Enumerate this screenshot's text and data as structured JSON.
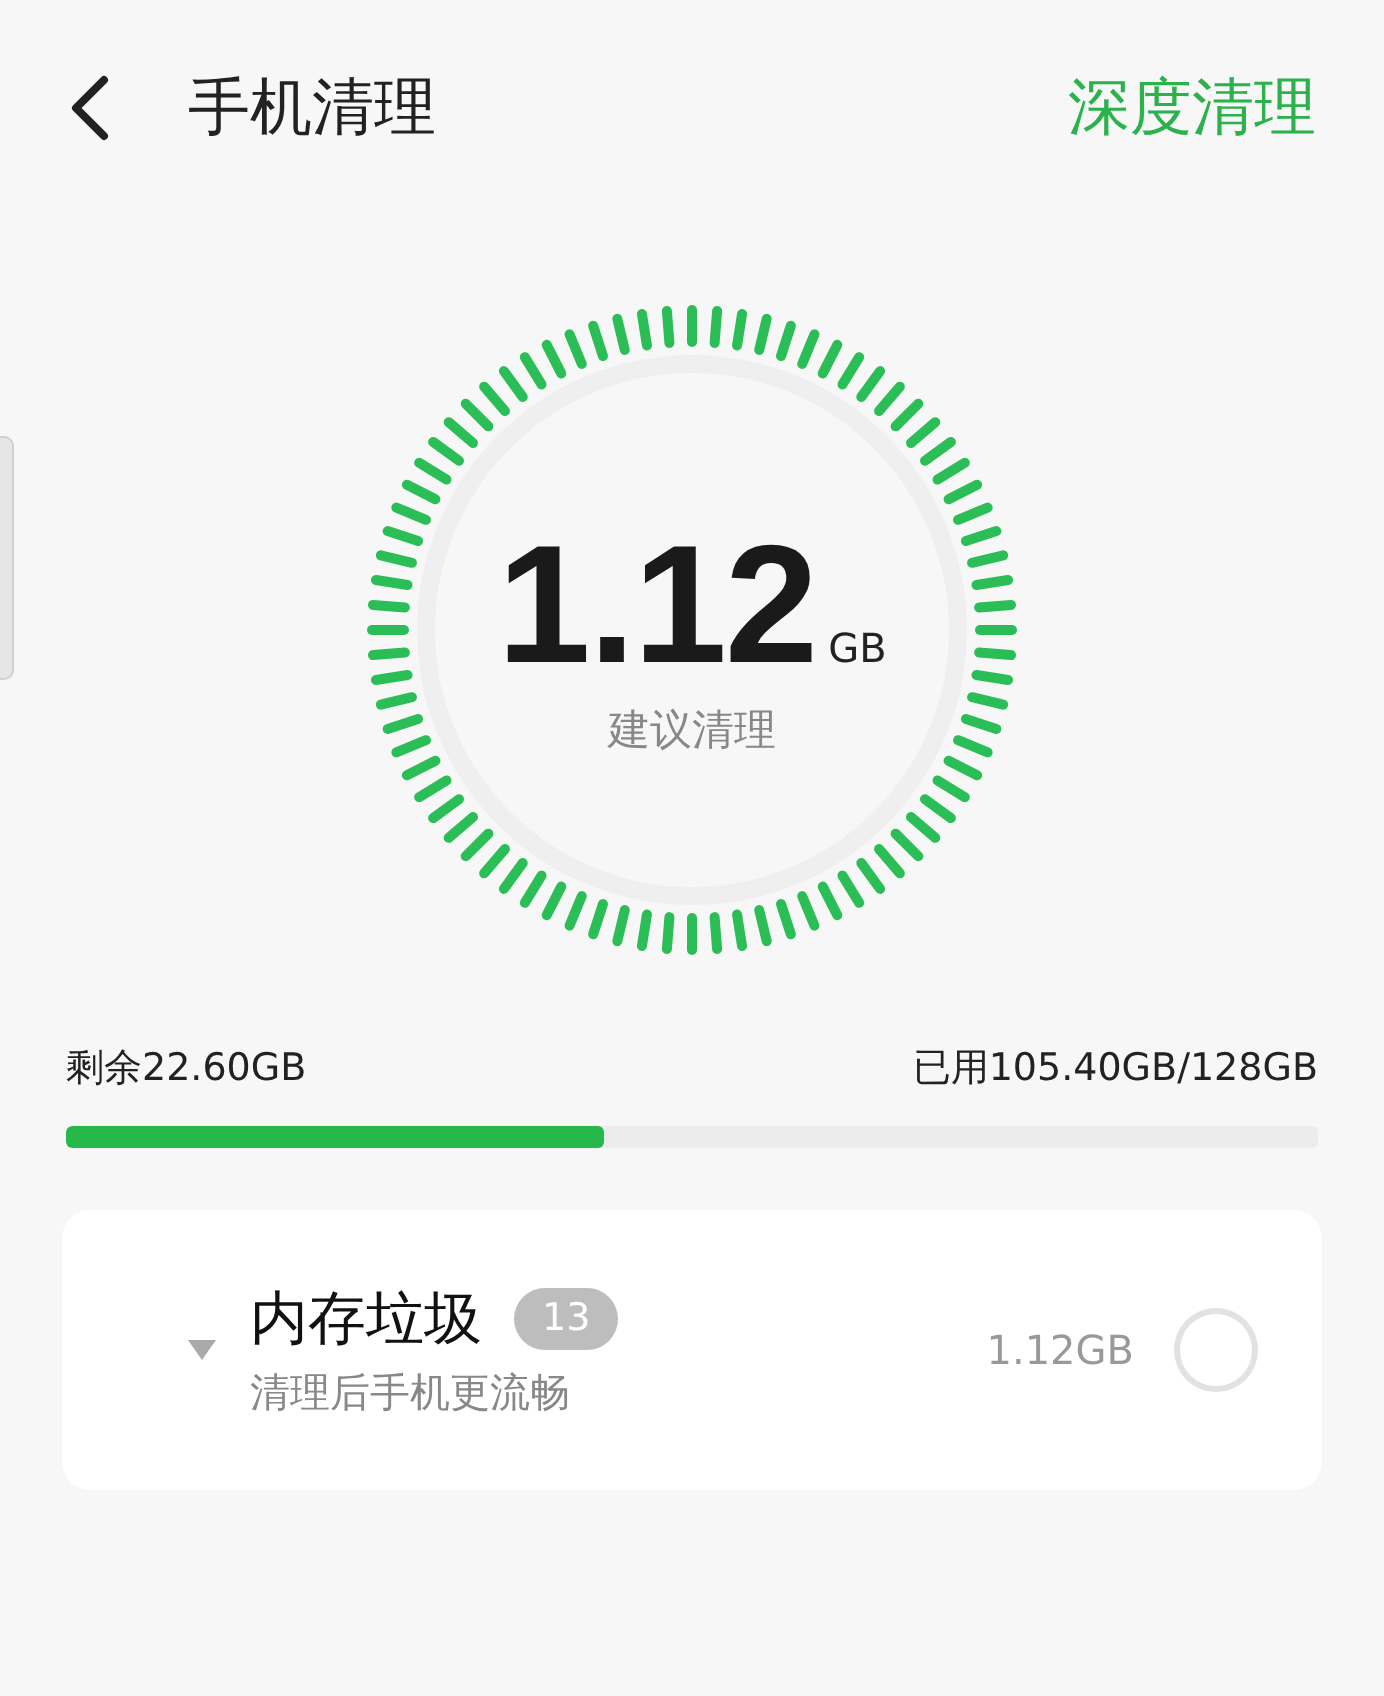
{
  "header": {
    "title": "手机清理",
    "action": "深度清理"
  },
  "gauge": {
    "value": "1.12",
    "unit": "GB",
    "caption": "建议清理"
  },
  "storage": {
    "remaining": "剩余22.60GB",
    "used": "已用105.40GB/128GB",
    "level": 0.43
  },
  "items": [
    {
      "title": "内存垃圾",
      "count": "13",
      "subtitle": "清理后手机更流畅",
      "size": "1.12GB",
      "checked": false
    }
  ]
}
